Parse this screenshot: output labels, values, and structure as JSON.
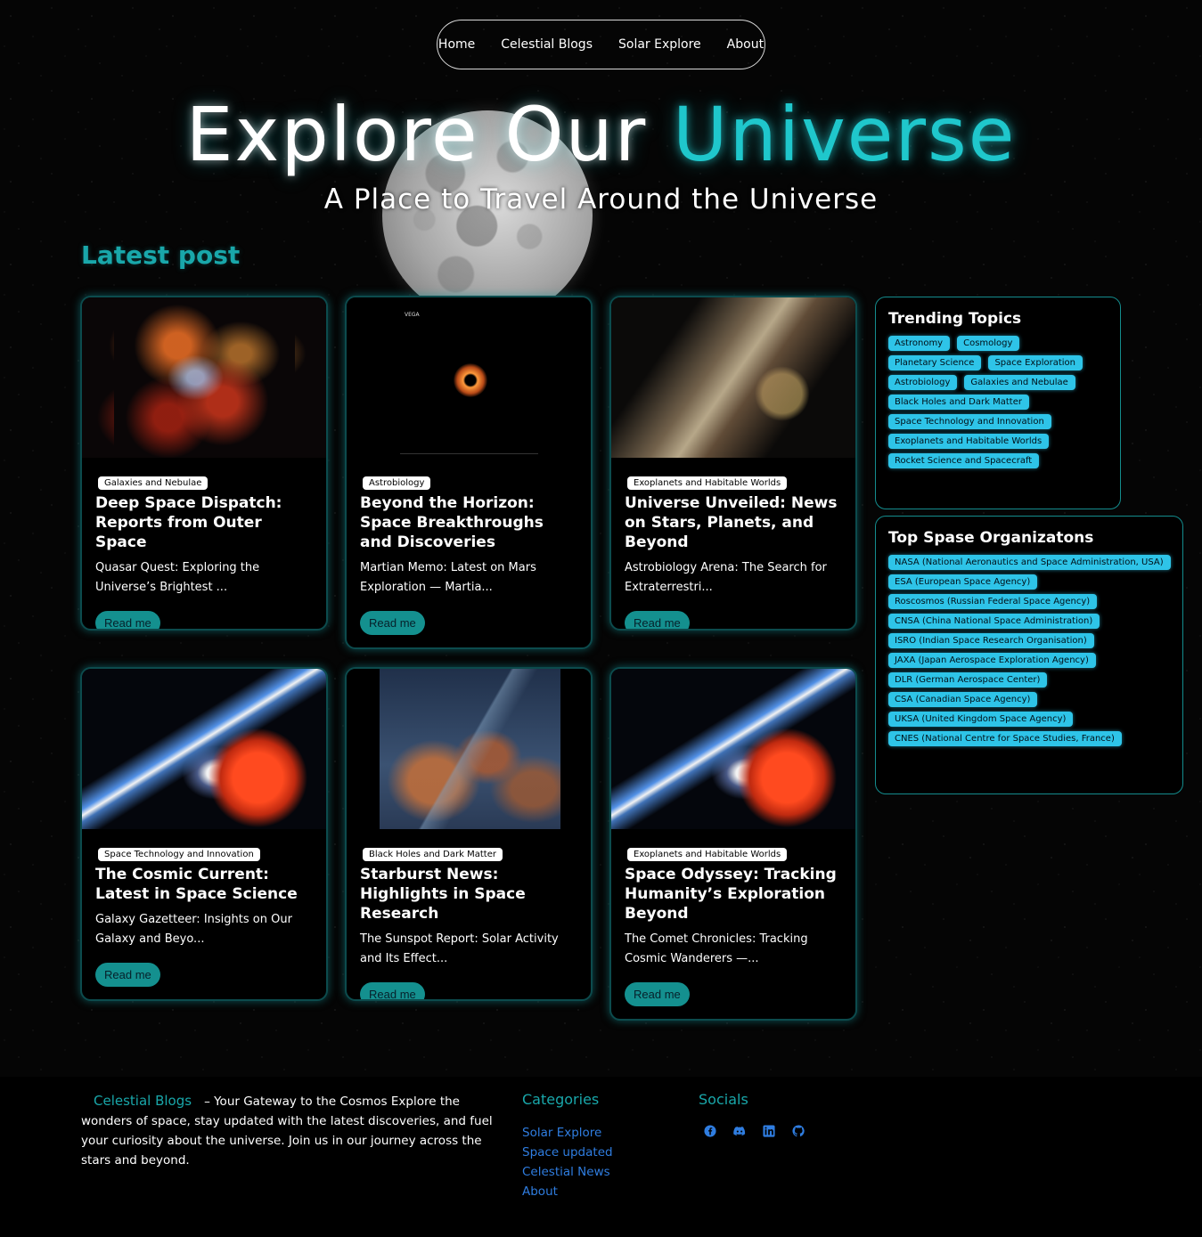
{
  "nav": {
    "items": [
      {
        "label": "Home"
      },
      {
        "label": "Celestial Blogs"
      },
      {
        "label": "Solar Explore"
      },
      {
        "label": "About"
      }
    ]
  },
  "hero": {
    "title_white": "Explore Our",
    "title_cyan": "Universe",
    "subtitle": "A Place to Travel Around the Universe"
  },
  "section": {
    "latest_heading": "Latest post"
  },
  "posts": [
    {
      "tag": "Galaxies and Nebulae",
      "title": "Deep Space Dispatch: Reports from Outer Space",
      "excerpt": "Quasar Quest: Exploring the Universe’s Brightest ...",
      "button": "Read me"
    },
    {
      "tag": "Astrobiology",
      "title": "Beyond the Horizon: Space Breakthroughs and Discoveries",
      "excerpt": "Martian Memo: Latest on Mars Exploration — Martia...",
      "button": "Read me",
      "thumb_title": "VEGA"
    },
    {
      "tag": "Exoplanets and Habitable Worlds",
      "title": "Universe Unveiled: News on Stars, Planets, and Beyond",
      "excerpt": "Astrobiology Arena: The Search for Extraterrestri...",
      "button": "Read me"
    },
    {
      "tag": "Space Technology and Innovation",
      "title": "The Cosmic Current: Latest in Space Science",
      "excerpt": "Galaxy Gazetteer: Insights on Our Galaxy and Beyo...",
      "button": "Read me"
    },
    {
      "tag": "Black Holes and Dark Matter",
      "title": "Starburst News: Highlights in Space Research",
      "excerpt": "The Sunspot Report: Solar Activity and Its Effect...",
      "button": "Read me"
    },
    {
      "tag": "Exoplanets and Habitable Worlds",
      "title": "Space Odyssey: Tracking Humanity’s Exploration Beyond",
      "excerpt": "The Comet Chronicles: Tracking Cosmic Wanderers —...",
      "button": "Read me"
    }
  ],
  "trending": {
    "heading": "Trending Topics",
    "topics": [
      "Astronomy",
      "Cosmology",
      "Planetary Science",
      "Space Exploration",
      "Astrobiology",
      "Galaxies and Nebulae",
      "Black Holes and Dark Matter",
      "Space Technology and Innovation",
      "Exoplanets and Habitable Worlds",
      "Rocket Science and Spacecraft"
    ]
  },
  "organizations": {
    "heading": "Top Spase Organizatons",
    "items": [
      "NASA (National Aeronautics and Space Administration, USA)",
      "ESA (European Space Agency)",
      "Roscosmos (Russian Federal Space Agency)",
      "CNSA (China National Space Administration)",
      "ISRO (Indian Space Research Organisation)",
      "JAXA (Japan Aerospace Exploration Agency)",
      "DLR (German Aerospace Center)",
      "CSA (Canadian Space Agency)",
      "UKSA (United Kingdom Space Agency)",
      "CNES (National Centre for Space Studies, France)"
    ]
  },
  "footer": {
    "brand": "Celestial Blogs",
    "about": "– Your Gateway to the Cosmos Explore the wonders of space, stay updated with the latest discoveries, and fuel your curiosity about the universe. Join us in our journey across the stars and beyond.",
    "categories_heading": "Categories",
    "categories": [
      "Solar Explore",
      "Space updated",
      "Celestial News",
      "About"
    ],
    "socials_heading": "Socials",
    "socials": [
      "facebook-icon",
      "discord-icon",
      "linkedin-icon",
      "github-icon"
    ]
  },
  "colors": {
    "accent": "#19a7aa",
    "chip": "#2ec4e8",
    "button": "#14908f",
    "link": "#2f7de0"
  }
}
